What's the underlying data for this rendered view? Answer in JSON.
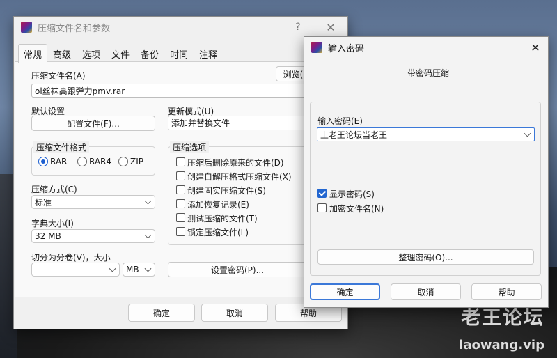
{
  "desktop": {
    "watermark_cn": "老王论坛",
    "watermark_en": "laowang.vip"
  },
  "archive_dialog": {
    "title": "压缩文件名和参数",
    "help_glyph": "?",
    "close_glyph": "✕",
    "tabs": [
      "常规",
      "高级",
      "选项",
      "文件",
      "备份",
      "时间",
      "注释"
    ],
    "archive_name_label": "压缩文件名(A)",
    "browse_button": "浏览(",
    "archive_name_value": "ol丝袜高跟弹力pmv.rar",
    "default_settings_label": "默认设置",
    "profiles_button": "配置文件(F)...",
    "update_mode_label": "更新模式(U)",
    "update_mode_value": "添加并替换文件",
    "format_group_title": "压缩文件格式",
    "formats": [
      {
        "label": "RAR",
        "selected": true
      },
      {
        "label": "RAR4",
        "selected": false
      },
      {
        "label": "ZIP",
        "selected": false
      }
    ],
    "options_group_title": "压缩选项",
    "options": [
      {
        "label": "压缩后删除原来的文件(D)",
        "checked": false
      },
      {
        "label": "创建自解压格式压缩文件(X)",
        "checked": false
      },
      {
        "label": "创建固实压缩文件(S)",
        "checked": false
      },
      {
        "label": "添加恢复记录(E)",
        "checked": false
      },
      {
        "label": "测试压缩的文件(T)",
        "checked": false
      },
      {
        "label": "锁定压缩文件(L)",
        "checked": false
      }
    ],
    "method_label": "压缩方式(C)",
    "method_value": "标准",
    "dict_label": "字典大小(I)",
    "dict_value": "32 MB",
    "split_label": "切分为分卷(V)，大小",
    "split_value": "",
    "split_unit": "MB",
    "set_password_button": "设置密码(P)...",
    "ok_button": "确定",
    "cancel_button": "取消",
    "help_button": "帮助"
  },
  "password_dialog": {
    "title": "输入密码",
    "close_glyph": "✕",
    "subtitle": "带密码压缩",
    "enter_password_label": "输入密码(E)",
    "password_value": "上老王论坛当老王",
    "show_password_label": "显示密码(S)",
    "show_password_checked": true,
    "encrypt_names_label": "加密文件名(N)",
    "encrypt_names_checked": false,
    "organize_button": "整理密码(O)...",
    "ok_button": "确定",
    "cancel_button": "取消",
    "help_button": "帮助"
  },
  "colors": {
    "accent": "#1d5fd0",
    "checkbox_on": "#2266d0",
    "primary_border": "#3b78d8"
  }
}
